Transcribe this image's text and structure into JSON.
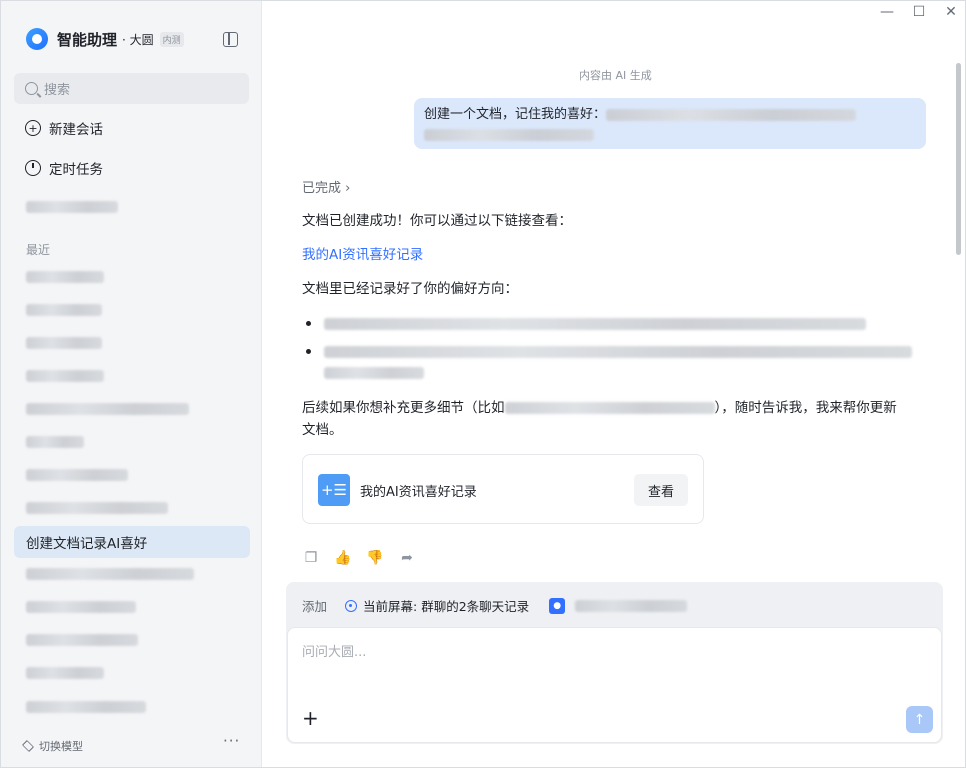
{
  "brand": {
    "name": "智能助理",
    "sub": "· 大圆",
    "badge": "内测"
  },
  "sidebar": {
    "search_placeholder": "搜索",
    "nav": [
      {
        "label": "新建会话"
      },
      {
        "label": "定时任务"
      }
    ],
    "recent_label": "最近",
    "active_conversation": "创建文档记录AI喜好",
    "model_switch": "切换模型",
    "more": "···"
  },
  "window": {
    "minimize": "—",
    "maximize": "☐",
    "close": "✕"
  },
  "chat": {
    "ai_note": "内容由 AI 生成",
    "user_message": "创建一个文档，记住我的喜好：",
    "done_label": "已完成 ›",
    "reply_line1": "文档已创建成功！你可以通过以下链接查看：",
    "doc_link": "我的AI资讯喜好记录",
    "reply_line2": "文档里已经记录好了你的偏好方向：",
    "reply_line3_a": "后续如果你想补充更多细节（比如",
    "reply_line3_b": "），随时告诉我，我来帮你更新",
    "reply_line3_c": "文档。",
    "doc_card": {
      "icon": "+☰",
      "title": "我的AI资讯喜好记录",
      "view_label": "查看"
    },
    "actions": [
      {
        "icon": "copy-icon",
        "glyph": "❐"
      },
      {
        "icon": "thumbs-up-icon",
        "glyph": "👍"
      },
      {
        "icon": "thumbs-down-icon",
        "glyph": "👎"
      },
      {
        "icon": "share-icon",
        "glyph": "➦"
      }
    ]
  },
  "composer": {
    "add_label": "添加",
    "screen_context": "当前屏幕: 群聊的2条聊天记录",
    "placeholder": "问问大圆...",
    "plus": "+",
    "send": "↑"
  }
}
